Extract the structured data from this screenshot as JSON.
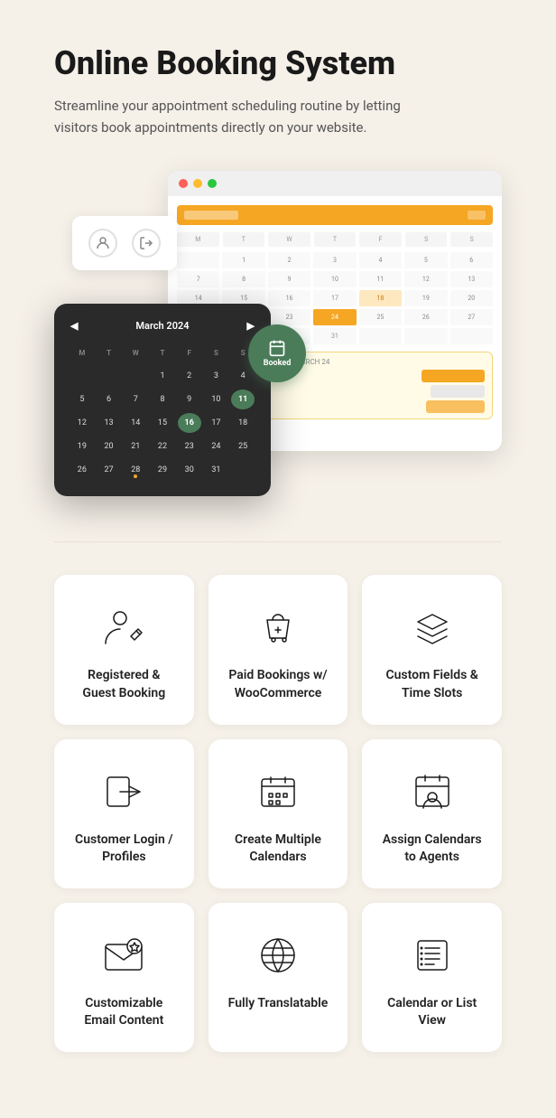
{
  "header": {
    "title": "Online Booking System",
    "subtitle": "Streamline your appointment scheduling routine by letting visitors book appointments directly on your website."
  },
  "hero": {
    "booked_label": "Booked",
    "calendar_month": "March 2024",
    "dark_cal_days": [
      "M",
      "T",
      "W",
      "T",
      "F",
      "S",
      "S"
    ],
    "dark_cal_numbers": [
      "",
      "",
      "",
      "1",
      "2",
      "3",
      "4",
      "5",
      "6",
      "7",
      "8",
      "9",
      "10",
      "11",
      "12",
      "13",
      "14",
      "15",
      "16",
      "17",
      "18",
      "19",
      "20",
      "21",
      "22",
      "23",
      "24",
      "25",
      "26",
      "27",
      "28",
      "29",
      "30",
      "31"
    ]
  },
  "features": [
    {
      "id": "registered-guest-booking",
      "icon": "person-edit-icon",
      "label": "Registered & Guest Booking"
    },
    {
      "id": "paid-bookings-woocommerce",
      "icon": "shopping-bag-icon",
      "label": "Paid Bookings w/ WooCommerce"
    },
    {
      "id": "custom-fields-time-slots",
      "icon": "layers-icon",
      "label": "Custom Fields & Time Slots"
    },
    {
      "id": "customer-login-profiles",
      "icon": "login-arrow-icon",
      "label": "Customer Login / Profiles"
    },
    {
      "id": "create-multiple-calendars",
      "icon": "multi-calendar-icon",
      "label": "Create Multiple Calendars"
    },
    {
      "id": "assign-calendars-agents",
      "icon": "calendar-person-icon",
      "label": "Assign Calendars to Agents"
    },
    {
      "id": "customizable-email-content",
      "icon": "email-star-icon",
      "label": "Customizable Email Content"
    },
    {
      "id": "fully-translatable",
      "icon": "globe-icon",
      "label": "Fully Translatable"
    },
    {
      "id": "calendar-or-list-view",
      "icon": "list-view-icon",
      "label": "Calendar or List View"
    }
  ]
}
